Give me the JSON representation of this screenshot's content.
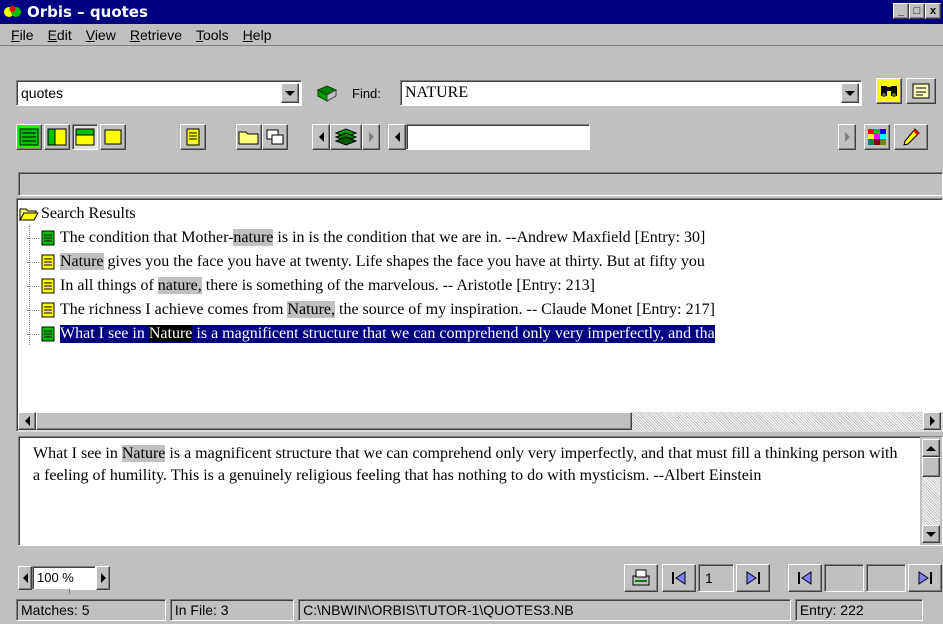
{
  "window": {
    "title": "Orbis – quotes",
    "controls": [
      "_",
      "□",
      "x"
    ]
  },
  "menu": [
    {
      "label": "File",
      "accel": "F"
    },
    {
      "label": "Edit",
      "accel": "E"
    },
    {
      "label": "View",
      "accel": "V"
    },
    {
      "label": "Retrieve",
      "accel": "R"
    },
    {
      "label": "Tools",
      "accel": "T"
    },
    {
      "label": "Help",
      "accel": "H"
    }
  ],
  "toolbar": {
    "database_value": "quotes",
    "find_label": "Find:",
    "find_value": "NATURE",
    "nav_field_value": ""
  },
  "tree": {
    "root_label": "Search Results",
    "results": [
      {
        "parts": [
          "The condition that Mother-",
          "nature",
          " is in is the condition that we are in. --Andrew Maxfield  [Entry: 30]"
        ],
        "icon": "green",
        "selected": false
      },
      {
        "parts": [
          "",
          "Nature",
          " gives you the face you have at twenty. Life shapes the face you have at thirty. But at fifty you"
        ],
        "icon": "yellow",
        "selected": false
      },
      {
        "parts": [
          "In all things of ",
          "nature,",
          " there is something of the marvelous. -- Aristotle [Entry: 213]"
        ],
        "icon": "yellow",
        "selected": false
      },
      {
        "parts": [
          "The richness I achieve comes from ",
          "Nature,",
          " the source of my inspiration. -- Claude Monet [Entry: 217]"
        ],
        "icon": "yellow",
        "selected": false
      },
      {
        "parts": [
          "What I see in ",
          "Nature",
          " is a magnificent structure that we can comprehend only very imperfectly, and tha"
        ],
        "icon": "green",
        "selected": true
      }
    ]
  },
  "preview": {
    "before": "What I see in ",
    "highlight": "Nature",
    "after": " is a magnificent structure that we can comprehend only very imperfectly, and that must fill a thinking person with a feeling of humility. This is a genuinely religious feeling that has nothing to do with mysticism. --Albert Einstein"
  },
  "zoom": {
    "value": "100 %"
  },
  "page_nav": {
    "current": "1"
  },
  "status": {
    "matches": "Matches: 5",
    "in_file": "In File: 3",
    "path": "C:\\NBWIN\\ORBIS\\TUTOR-1\\QUOTES3.NB",
    "entry": "Entry: 222"
  },
  "colors": {
    "titlebar": "#000080",
    "selection": "#000080",
    "match_highlight": "#c0c0c0",
    "chrome": "#c0c0c0"
  }
}
